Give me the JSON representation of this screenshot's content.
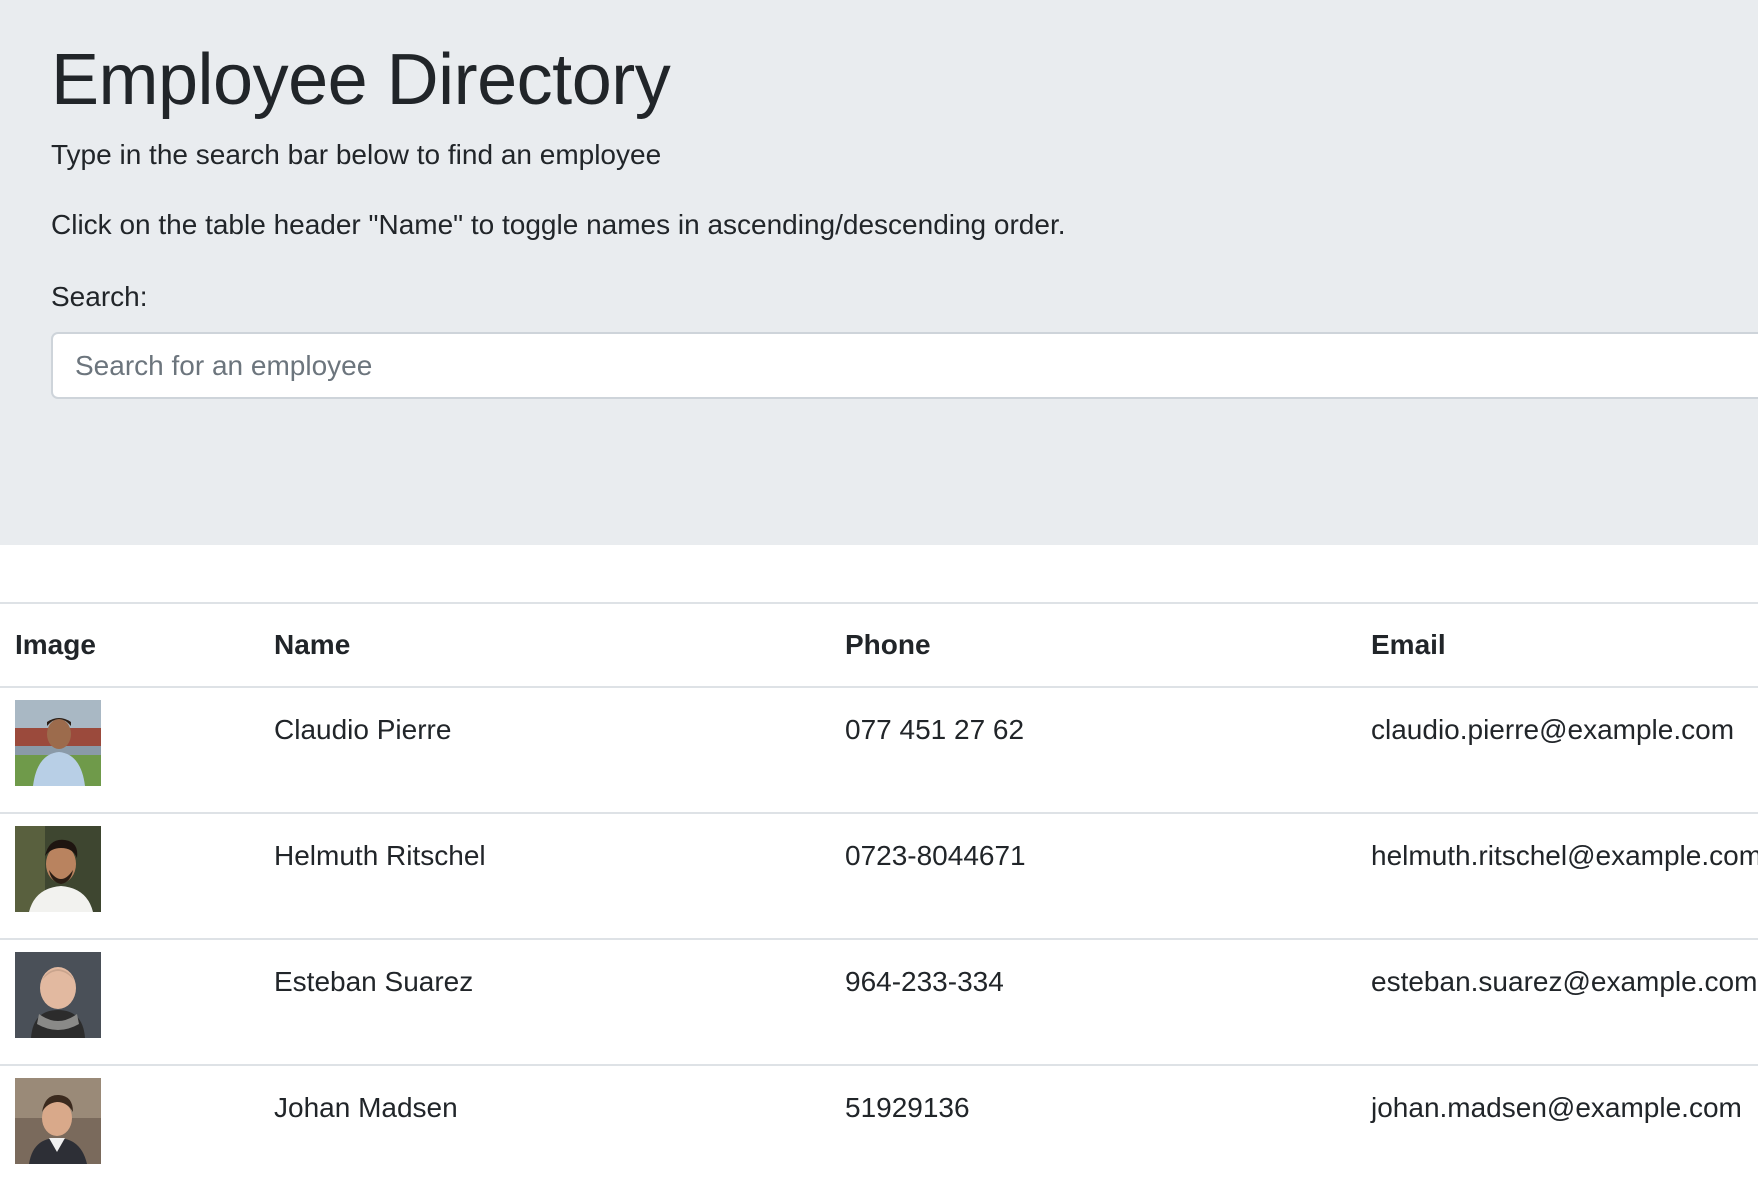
{
  "header": {
    "title": "Employee Directory",
    "instruction_1": "Type in the search bar below to find an employee",
    "instruction_2": "Click on the table header \"Name\" to toggle names in ascending/descending order."
  },
  "search": {
    "label": "Search:",
    "placeholder": "Search for an employee",
    "value": ""
  },
  "table": {
    "columns": [
      "Image",
      "Name",
      "Phone",
      "Email"
    ],
    "rows": [
      {
        "name": "Claudio Pierre",
        "phone": "077 451 27 62",
        "email": "claudio.pierre@example.com",
        "avatar": "photo-claudio-pierre"
      },
      {
        "name": "Helmuth Ritschel",
        "phone": "0723-8044671",
        "email": "helmuth.ritschel@example.com",
        "avatar": "photo-helmuth-ritschel"
      },
      {
        "name": "Esteban Suarez",
        "phone": "964-233-334",
        "email": "esteban.suarez@example.com",
        "avatar": "photo-esteban-suarez"
      },
      {
        "name": "Johan Madsen",
        "phone": "51929136",
        "email": "johan.madsen@example.com",
        "avatar": "photo-johan-madsen"
      }
    ]
  },
  "colors": {
    "jumbotron_bg": "#e9ecef",
    "text": "#212529",
    "border": "#dee2e6",
    "placeholder": "#6c757d"
  }
}
